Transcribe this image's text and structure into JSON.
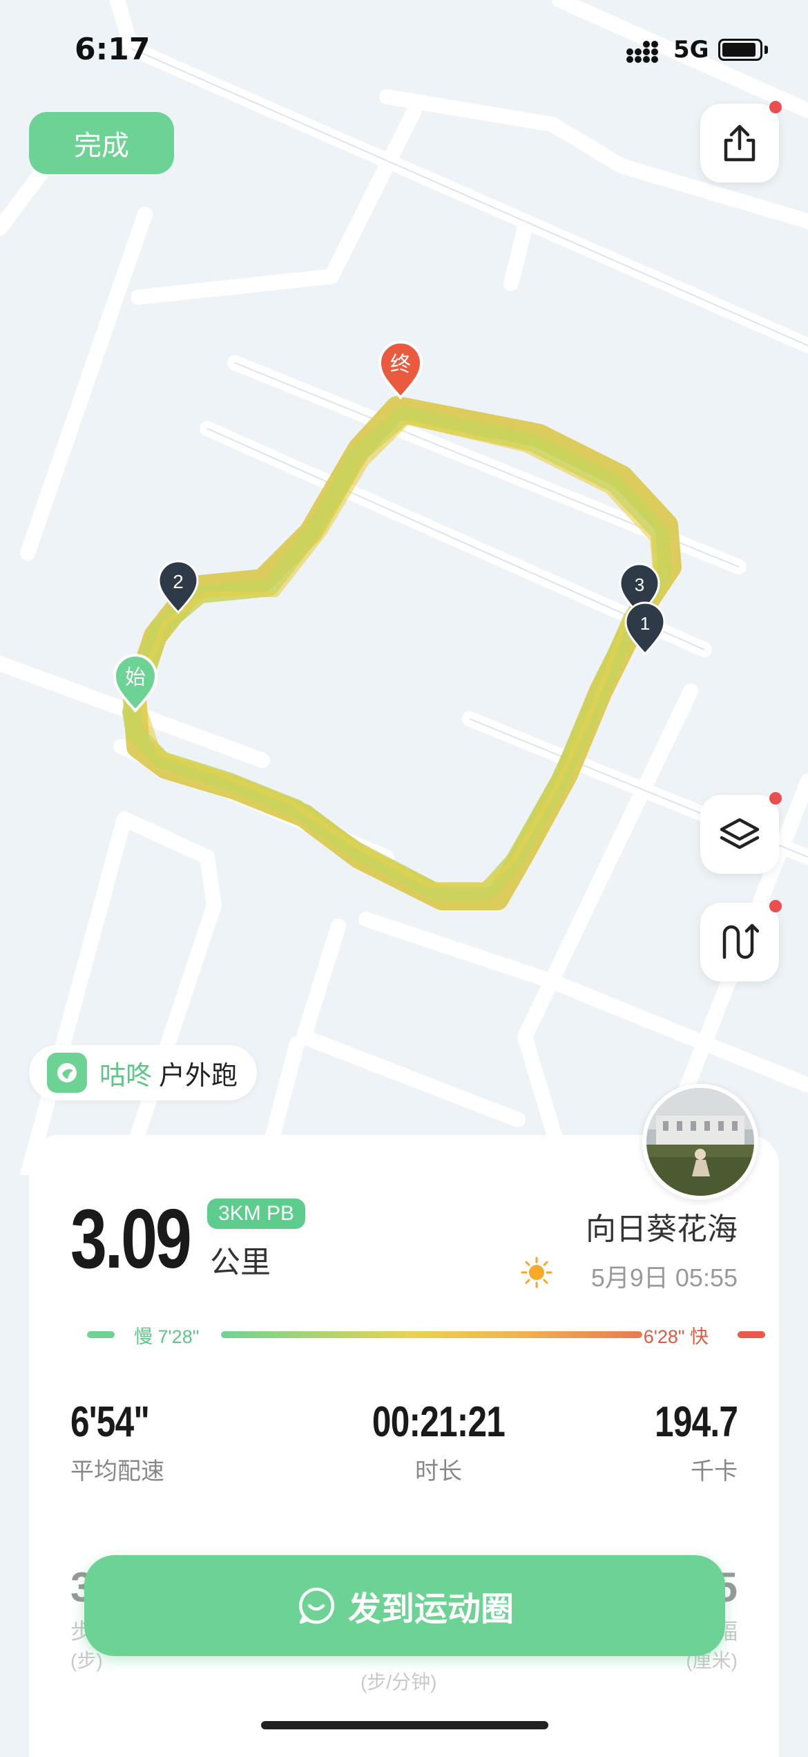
{
  "status_bar": {
    "time": "6:17",
    "network": "5G"
  },
  "header": {
    "done_label": "完成"
  },
  "map": {
    "start_label": "始",
    "end_label": "终",
    "km_markers": [
      "1",
      "2",
      "3"
    ]
  },
  "brand": {
    "name": "咕咚",
    "activity": "户外跑"
  },
  "summary": {
    "distance": "3.09",
    "distance_unit": "公里",
    "pb_badge": "3KM PB",
    "route_name": "向日葵花海",
    "date_time": "5月9日 05:55",
    "pace_slow": "慢 7'28\"",
    "pace_fast": "6'28\" 快"
  },
  "stats": [
    {
      "value": "6'54\"",
      "label": "平均配速"
    },
    {
      "value": "00:21:21",
      "label": "时长"
    },
    {
      "value": "194.7",
      "label": "千卡"
    }
  ],
  "hidden_stats": {
    "left_value": "3",
    "left_label": "步",
    "left_sub": "(步)",
    "mid_sub": "(步/分钟)",
    "right_value": "5",
    "right_label": "幅",
    "right_sub": "(厘米)"
  },
  "post_button": {
    "label": "发到运动圈"
  },
  "colors": {
    "accent": "#6dd394",
    "end_marker": "#e95a3e",
    "km_marker": "#2e3a48",
    "track": "#cdd45a"
  },
  "icons": {
    "share": "share-icon",
    "layers": "layers-icon",
    "route": "route-icon",
    "weather": "sun-icon",
    "chat": "chat-bubble-icon"
  }
}
